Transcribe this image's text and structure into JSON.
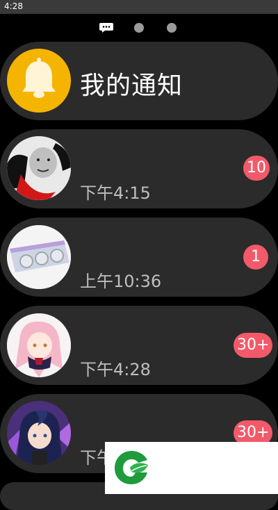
{
  "status_bar": {
    "time": "4:28"
  },
  "pager": {
    "pages": [
      "chat-icon",
      "dot",
      "dot"
    ],
    "active_index": 0
  },
  "notification_entry": {
    "title": "我的通知",
    "icon": "bell-icon"
  },
  "conversations": [
    {
      "avatar": "meme-face-avatar",
      "name": "",
      "time": "下午4:15",
      "badge": "10"
    },
    {
      "avatar": "graphics-card-avatar",
      "name": "",
      "time": "上午10:36",
      "badge": "1"
    },
    {
      "avatar": "anime-girl-pink-hair-avatar",
      "name": "",
      "time": "下午4:28",
      "badge": "30+"
    },
    {
      "avatar": "anime-girl-blue-hair-avatar",
      "name": "",
      "time": "下午",
      "badge": "30+"
    }
  ],
  "watermark": {
    "logo": "green-leaf-logo"
  },
  "colors": {
    "background": "#000000",
    "card": "#2b2b2b",
    "badge": "#f25a6a",
    "bell_circle": "#f5b400",
    "time_text": "#bfbfbf"
  }
}
